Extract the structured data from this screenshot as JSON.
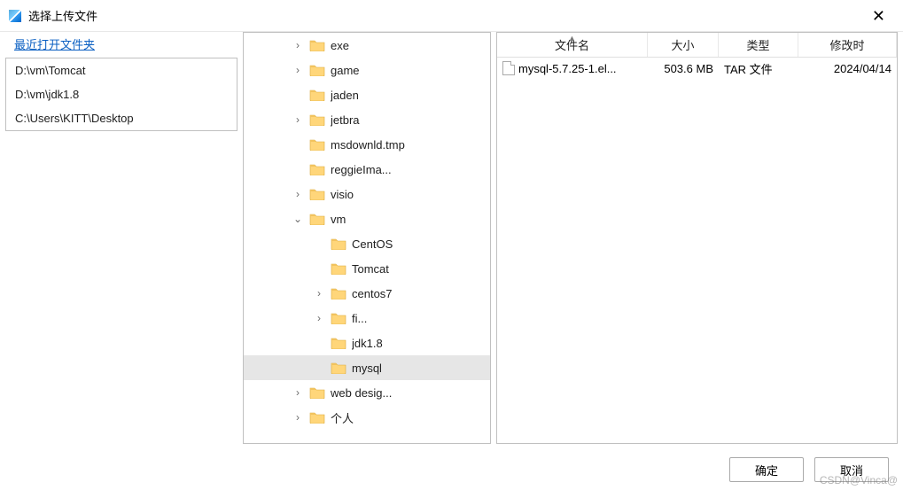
{
  "title": "选择上传文件",
  "recent_label": "最近打开文件夹",
  "recent_paths": [
    "D:\\vm\\Tomcat",
    "D:\\vm\\jdk1.8",
    "C:\\Users\\KITT\\Desktop"
  ],
  "tree": [
    {
      "label": "exe",
      "indent": 1,
      "toggle": ">"
    },
    {
      "label": "game",
      "indent": 1,
      "toggle": ">"
    },
    {
      "label": "jaden",
      "indent": 1,
      "toggle": ""
    },
    {
      "label": "jetbra",
      "indent": 1,
      "toggle": ">"
    },
    {
      "label": "msdownld.tmp",
      "indent": 1,
      "toggle": ""
    },
    {
      "label": "reggieIma...",
      "indent": 1,
      "toggle": ""
    },
    {
      "label": "visio",
      "indent": 1,
      "toggle": ">"
    },
    {
      "label": "vm",
      "indent": 1,
      "toggle": "v"
    },
    {
      "label": "CentOS",
      "indent": 2,
      "toggle": ""
    },
    {
      "label": "Tomcat",
      "indent": 2,
      "toggle": ""
    },
    {
      "label": "centos7",
      "indent": 2,
      "toggle": ">"
    },
    {
      "label": "fi...",
      "indent": 2,
      "toggle": ">"
    },
    {
      "label": "jdk1.8",
      "indent": 2,
      "toggle": ""
    },
    {
      "label": "mysql",
      "indent": 2,
      "toggle": "",
      "selected": true
    },
    {
      "label": "web desig...",
      "indent": 1,
      "toggle": ">"
    },
    {
      "label": "个人",
      "indent": 1,
      "toggle": ">"
    }
  ],
  "columns": {
    "name": "文件名",
    "size": "大小",
    "type": "类型",
    "date": "修改时"
  },
  "files": [
    {
      "name": "mysql-5.7.25-1.el...",
      "size": "503.6 MB",
      "type": "TAR 文件",
      "date": "2024/04/14"
    }
  ],
  "buttons": {
    "ok": "确定",
    "cancel": "取消"
  },
  "watermark": "CSDN@Vinca@"
}
